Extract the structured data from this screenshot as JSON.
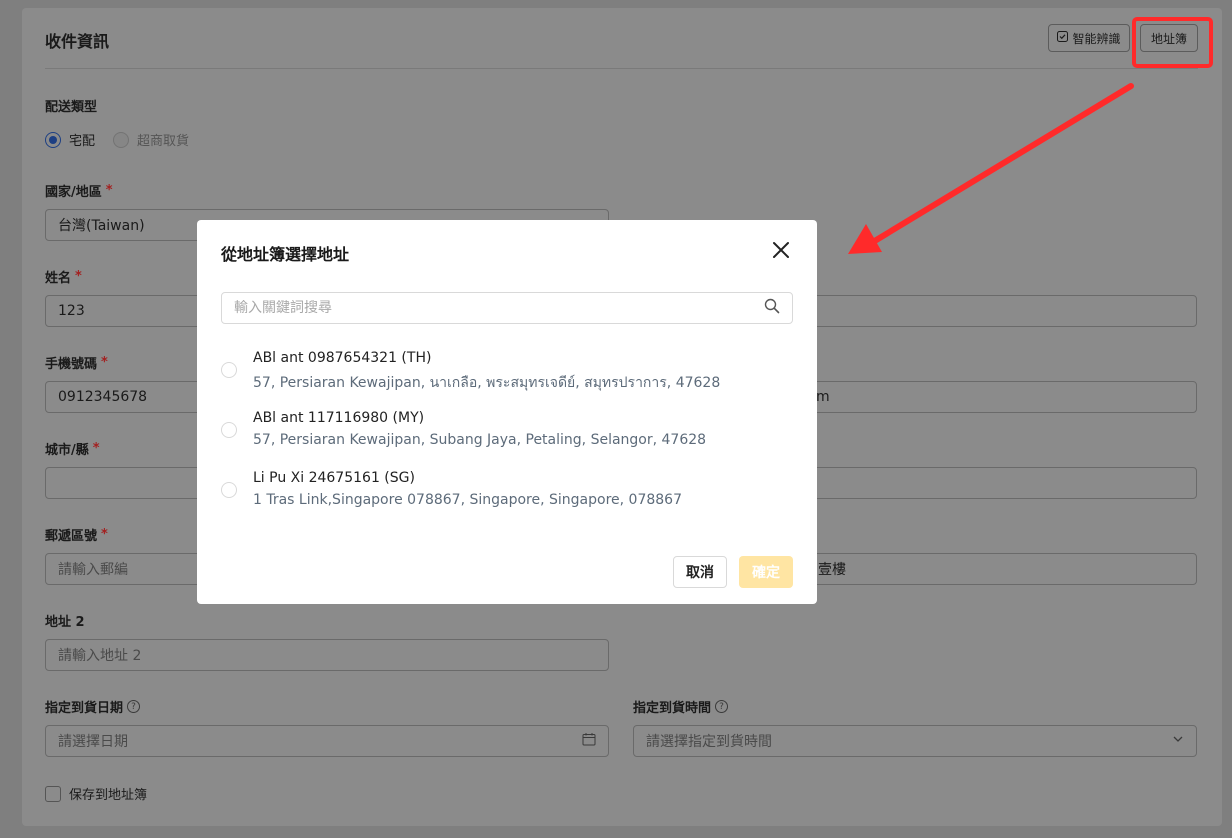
{
  "card": {
    "title": "收件資訊",
    "smart_btn": "智能辨識",
    "book_btn": "地址簿"
  },
  "delivery": {
    "label": "配送類型",
    "options": [
      "宅配",
      "超商取貨"
    ],
    "selected": "宅配"
  },
  "fields": {
    "country_label": "國家/地區",
    "country_value": "台灣(Taiwan)",
    "name_label": "姓名",
    "name_value": "123",
    "phone_label": "手機號碼",
    "phone_value": "0912345678",
    "email_partial": "m",
    "city_label": "城市/縣",
    "zip_label": "郵遞區號",
    "zip_placeholder": "請輸入郵編",
    "address1_partial": "壹樓",
    "address2_label": "地址 2",
    "address2_placeholder": "請輸入地址 2",
    "date_label": "指定到貨日期",
    "date_placeholder": "請選擇日期",
    "time_label": "指定到貨時間",
    "time_placeholder": "請選擇指定到貨時間",
    "save_label": "保存到地址簿",
    "required_mark": "*",
    "help_mark": "?"
  },
  "modal": {
    "title": "從地址簿選擇地址",
    "search_placeholder": "輸入關鍵詞搜尋",
    "addresses": [
      {
        "name": "ABl ant 0987654321 (TH)",
        "address": "57, Persiaran Kewajipan, นาเกลือ, พระสมุทรเจดีย์, สมุทรปราการ, 47628"
      },
      {
        "name": "ABl ant 117116980 (MY)",
        "address": "57, Persiaran Kewajipan, Subang Jaya, Petaling, Selangor, 47628"
      },
      {
        "name": "Li Pu Xi 24675161 (SG)",
        "address": "1 Tras Link,Singapore 078867, Singapore, Singapore, 078867"
      }
    ],
    "cancel_label": "取消",
    "confirm_label": "確定"
  },
  "colors": {
    "annotation": "#ff2a2a",
    "confirm_disabled": "#ffe5a3",
    "radio_selected": "#1d3f83"
  }
}
